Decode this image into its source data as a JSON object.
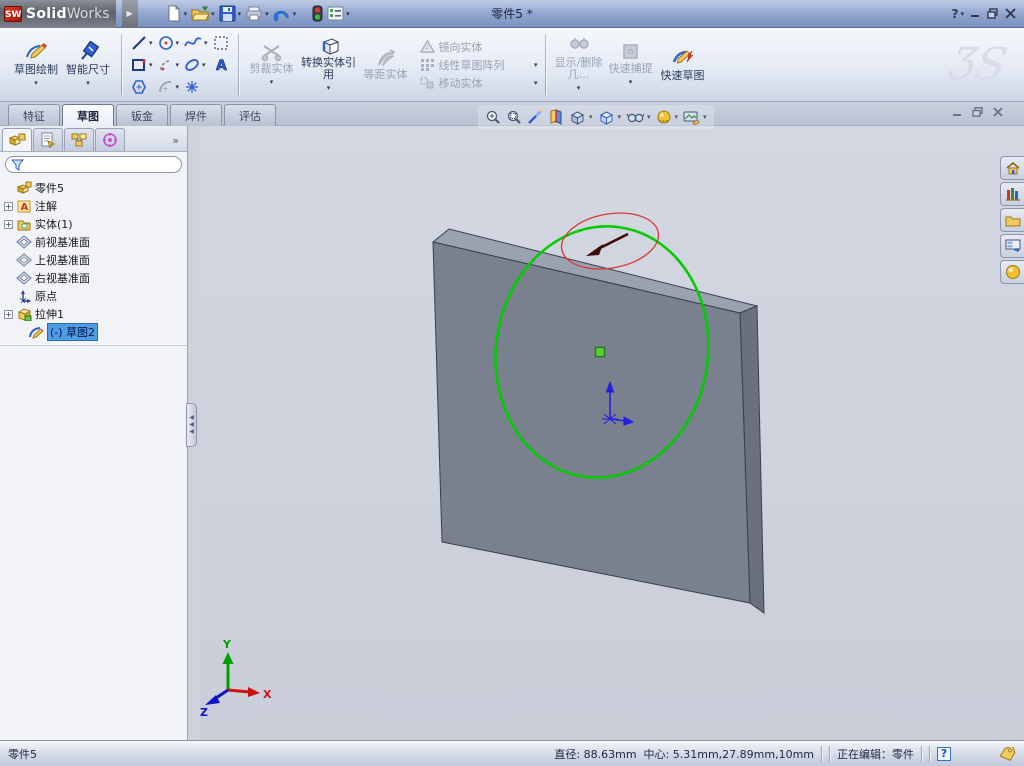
{
  "window": {
    "brand": {
      "bold": "Solid",
      "light": "Works"
    },
    "title": "零件5 *",
    "help_label": "?"
  },
  "titlebar_toolbar": {
    "icons": [
      "new-document",
      "open-document",
      "save",
      "print",
      "undo",
      "rebuild-traffic-light",
      "options"
    ]
  },
  "ribbon": {
    "sketch_draw": "草图绘制",
    "smart_dimension": "智能尺寸",
    "trim_entities": "剪裁实体",
    "convert_entities": "转换实体引用",
    "offset_entities": "等距实体",
    "mirror_entities": "镜向实体",
    "linear_pattern": "线性草图阵列",
    "move_entities": "移动实体",
    "display_delete_relations": "显示/删除几...",
    "quick_snaps": "快速捕提",
    "rapid_sketch": "快速草图",
    "sketch_tool_icons": [
      "line",
      "circle",
      "spline",
      "selection-box",
      "rectangle",
      "arc",
      "ellipse",
      "text",
      "polygon",
      "fillet",
      "point"
    ]
  },
  "command_tabs": [
    {
      "label": "特征"
    },
    {
      "label": "草图"
    },
    {
      "label": "钣金"
    },
    {
      "label": "焊件"
    },
    {
      "label": "评估"
    }
  ],
  "headsup": {
    "icons": [
      "zoom-to-fit",
      "zoom-to-area",
      "magnified-selection",
      "section-view",
      "view-orientation",
      "display-style",
      "hide-show-items",
      "appearances",
      "apply-scene"
    ]
  },
  "panel_tabs": {
    "icons": [
      "featuremanager",
      "propertymanager",
      "configurationmanager",
      "dimxpertmanager"
    ],
    "expand": "»"
  },
  "feature_tree": {
    "root": "零件5",
    "items": [
      {
        "label": "注解"
      },
      {
        "label": "实体(1)"
      },
      {
        "label": "前视基准面"
      },
      {
        "label": "上视基准面"
      },
      {
        "label": "右视基准面"
      },
      {
        "label": "原点"
      },
      {
        "label": "拉伸1"
      },
      {
        "label": "(-) 草图2"
      }
    ]
  },
  "viewport": {
    "triad": {
      "x": "X",
      "y": "Y",
      "z": "Z"
    },
    "sketch_circle_color": "#00cc00",
    "highlight_color": "#dd3333"
  },
  "task_pane": {
    "icons": [
      "solidworks-resources-home",
      "design-library",
      "file-explorer",
      "custom-properties",
      "appearances-scenes"
    ]
  },
  "status_bar": {
    "left": "零件5",
    "diameter": "直径: 88.63mm",
    "center": "中心: 5.31mm,27.89mm,10mm",
    "editing": "正在编辑：零件",
    "help": "?"
  }
}
